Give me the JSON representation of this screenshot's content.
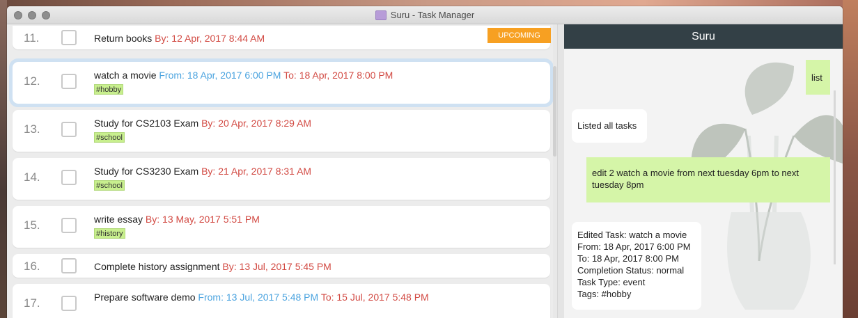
{
  "window": {
    "title": "Suru - Task Manager"
  },
  "tasks": [
    {
      "num": "11.",
      "name": "Return books",
      "date1": "By: 12 Apr, 2017 8:44 AM",
      "badge": "UPCOMING"
    },
    {
      "num": "12.",
      "name": "watch a movie",
      "from": "From: 18 Apr, 2017 6:00 PM",
      "to": "To: 18 Apr, 2017 8:00 PM",
      "tag": "#hobby"
    },
    {
      "num": "13.",
      "name": "Study for CS2103 Exam",
      "date1": "By: 20 Apr, 2017 8:29 AM",
      "tag": "#school"
    },
    {
      "num": "14.",
      "name": "Study for CS3230 Exam",
      "date1": "By: 21 Apr, 2017 8:31 AM",
      "tag": "#school"
    },
    {
      "num": "15.",
      "name": "write essay",
      "date1": "By: 13 May, 2017 5:51 PM",
      "tag": "#history"
    },
    {
      "num": "16.",
      "name": "Complete history assignment",
      "date1": "By: 13 Jul, 2017 5:45 PM"
    },
    {
      "num": "17.",
      "name": "Prepare software demo",
      "from": "From: 13 Jul, 2017 5:48 PM",
      "to": "To: 15 Jul, 2017 5:48 PM"
    }
  ],
  "chat": {
    "header": "Suru",
    "messages": [
      {
        "role": "user",
        "text": "list"
      },
      {
        "role": "bot",
        "text": "Listed all tasks"
      },
      {
        "role": "user",
        "text": "edit 2 watch a movie from next tuesday 6pm to next tuesday 8pm"
      },
      {
        "role": "bot",
        "lines": [
          "Edited Task: watch a movie",
          "From: 18 Apr, 2017 6:00 PM",
          "To: 18 Apr, 2017 8:00 PM",
          "Completion Status: normal",
          "Task Type: event",
          "Tags: #hobby"
        ]
      }
    ]
  },
  "colors": {
    "header_bg": "#334046",
    "upcoming_badge": "#f7a022",
    "deadline_red": "#d24a43",
    "event_blue": "#4aa3df",
    "tag_green": "#c8ef8e",
    "user_bubble": "#d5f5a8"
  }
}
